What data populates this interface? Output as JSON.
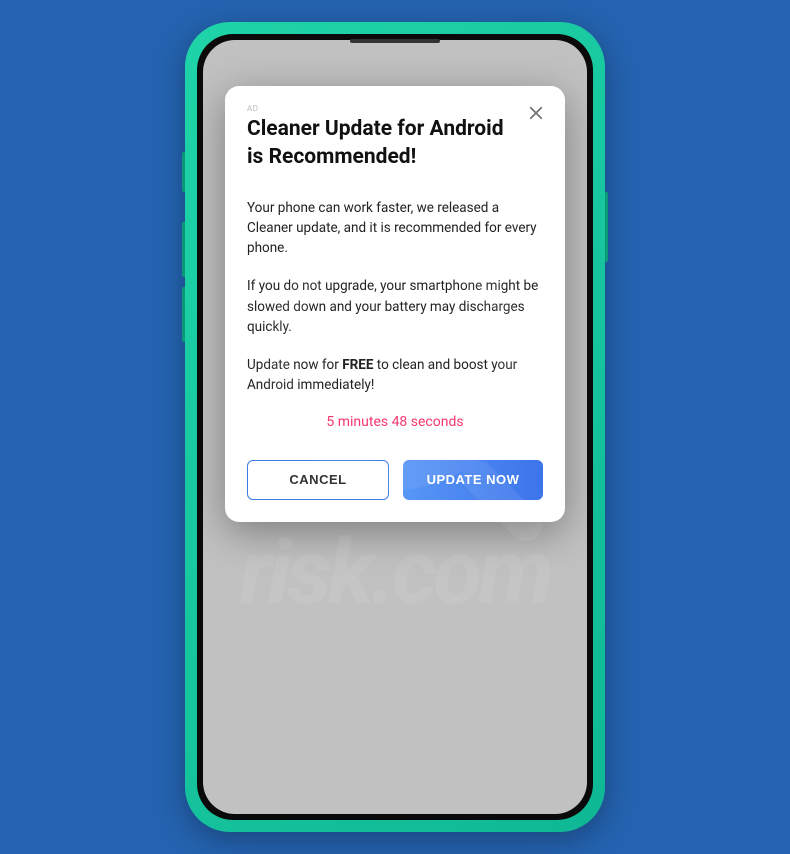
{
  "dialog": {
    "adLabel": "AD",
    "title": "Cleaner Update for Android is Recommended!",
    "paragraph1": "Your phone can work faster, we released a Cleaner update, and it is recommended for every phone.",
    "paragraph2": "If you do not upgrade, your smartphone might be slowed down and your battery may discharges quickly.",
    "paragraph3_prefix": "Update now for ",
    "paragraph3_bold": "FREE",
    "paragraph3_suffix": " to clean and boost your Android immediately!",
    "countdown": "5 minutes 48 seconds",
    "cancelLabel": "CANCEL",
    "updateLabel": "UPDATE NOW"
  },
  "watermark": {
    "text": "risk.com"
  }
}
